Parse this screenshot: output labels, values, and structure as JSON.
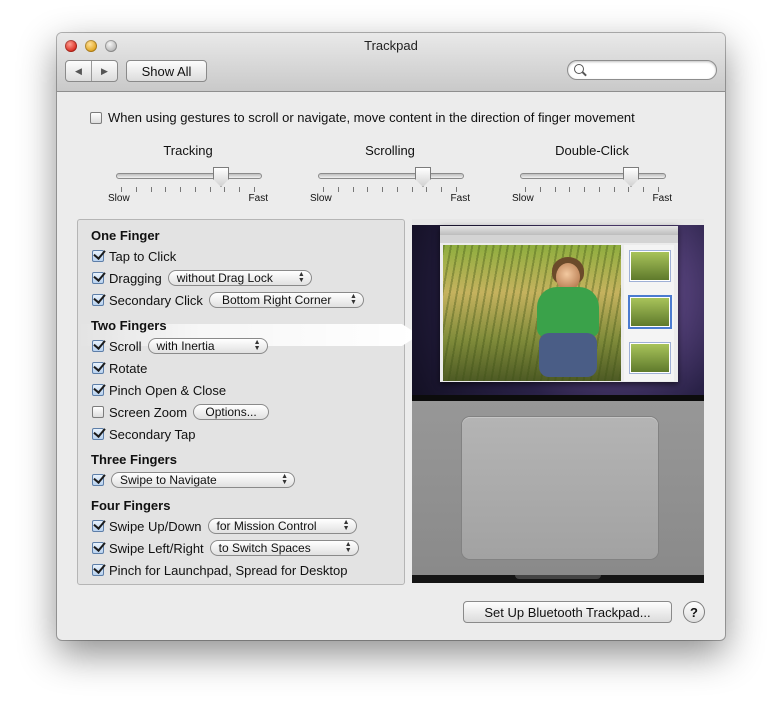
{
  "window": {
    "title": "Trackpad"
  },
  "toolbar": {
    "back_icon": "◀",
    "forward_icon": "▶",
    "show_all": "Show All",
    "search": {
      "value": "",
      "placeholder": ""
    }
  },
  "natural_scroll": {
    "label": "When using gestures to scroll or navigate, move content in the direction of finger movement",
    "checked": false
  },
  "sliders": [
    {
      "label": "Tracking",
      "min_label": "Slow",
      "max_label": "Fast",
      "value": 0.75
    },
    {
      "label": "Scrolling",
      "min_label": "Slow",
      "max_label": "Fast",
      "value": 0.75
    },
    {
      "label": "Double-Click",
      "min_label": "Slow",
      "max_label": "Fast",
      "value": 0.8
    }
  ],
  "groups": {
    "one_finger": {
      "title": "One Finger",
      "tap_to_click": {
        "label": "Tap to Click",
        "checked": true
      },
      "dragging": {
        "label": "Dragging",
        "checked": true,
        "option": "without Drag Lock"
      },
      "secondary_click": {
        "label": "Secondary Click",
        "checked": true,
        "option": "Bottom Right Corner"
      }
    },
    "two_fingers": {
      "title": "Two Fingers",
      "scroll": {
        "label": "Scroll",
        "checked": true,
        "option": "with Inertia"
      },
      "rotate": {
        "label": "Rotate",
        "checked": true
      },
      "pinch": {
        "label": "Pinch Open & Close",
        "checked": true
      },
      "screen_zoom": {
        "label": "Screen Zoom",
        "checked": false,
        "button": "Options..."
      },
      "secondary_tap": {
        "label": "Secondary Tap",
        "checked": true
      }
    },
    "three_fingers": {
      "title": "Three Fingers",
      "swipe": {
        "checked": true,
        "option": "Swipe to Navigate"
      }
    },
    "four_fingers": {
      "title": "Four Fingers",
      "swipe_up_down": {
        "label": "Swipe Up/Down",
        "checked": true,
        "option": "for Mission Control"
      },
      "swipe_left_right": {
        "label": "Swipe Left/Right",
        "checked": true,
        "option": "to Switch Spaces"
      },
      "pinch_launchpad": {
        "label": "Pinch for Launchpad, Spread for Desktop",
        "checked": true
      }
    }
  },
  "footer": {
    "setup_bluetooth": "Set Up Bluetooth Trackpad...",
    "help": "?"
  },
  "colors": {
    "window_bg": "#ececec",
    "panel_bg": "#e3e3e3",
    "checkbox_on": "#b9d2ef"
  }
}
